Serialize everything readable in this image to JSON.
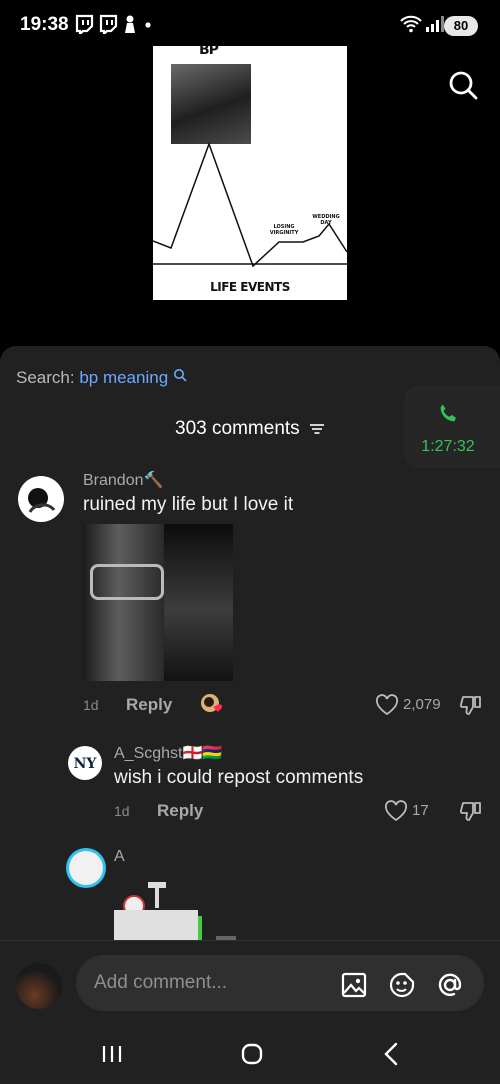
{
  "status_bar": {
    "time": "19:38",
    "battery": "80"
  },
  "video": {
    "poster_title": "BP",
    "poster_footer": "LIFE EVENTS",
    "label_losing": "LOSING VIRGINITY",
    "label_wedding": "WEDDING DAY"
  },
  "sheet": {
    "search_prefix": "Search: ",
    "search_query": "bp meaning",
    "comment_count": "303 comments"
  },
  "call": {
    "timer": "1:27:32",
    "color": "#34c55a"
  },
  "comments": [
    {
      "username": "Brandon🔨",
      "text": "ruined my life but I love it",
      "date": "1d",
      "reply_label": "Reply",
      "likes": "2,079"
    },
    {
      "username": "A_Scghst🏴󠁧󠁢󠁥󠁮󠁧󠁿🇲🇺",
      "text": "wish i could repost comments",
      "date": "1d",
      "reply_label": "Reply",
      "likes": "17"
    },
    {
      "username": "A"
    }
  ],
  "composer": {
    "placeholder": "Add comment..."
  },
  "colors": {
    "sheet_bg": "#212121",
    "link_blue": "#6aa9ff"
  }
}
